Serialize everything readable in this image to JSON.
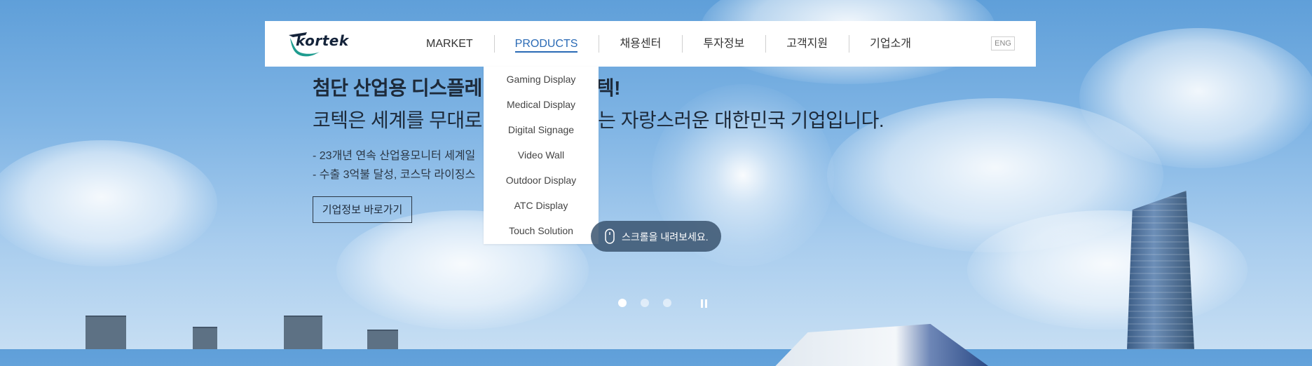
{
  "brand": {
    "logo_text": "kortek"
  },
  "nav": {
    "items": [
      {
        "label": "MARKET"
      },
      {
        "label": "PRODUCTS",
        "active": true
      },
      {
        "label": "채용센터"
      },
      {
        "label": "투자정보"
      },
      {
        "label": "고객지원"
      },
      {
        "label": "기업소개"
      }
    ],
    "lang_button": "ENG"
  },
  "hero": {
    "headline_visible_left": "첨단 산업용 디스플레",
    "headline_visible_right": "텍!",
    "subline_visible_left": "코텍은 세계를 무대로",
    "subline_visible_right": "드는 자랑스러운 대한민국 기업입니다.",
    "bullet1_visible": "- 23개년 연속 산업용모니터 세계일",
    "bullet2_visible": "- 수출 3억불 달성, 코스닥 라이징스",
    "cta_label": "기업정보 바로가기"
  },
  "products_dropdown": {
    "items": [
      "Gaming Display",
      "Medical Display",
      "Digital Signage",
      "Video Wall",
      "Outdoor Display",
      "ATC Display",
      "Touch Solution"
    ]
  },
  "scroll_hint": {
    "label": "스크롤을 내려보세요."
  },
  "slider": {
    "slide_count": 3,
    "current_slide": 1
  },
  "colors": {
    "accent": "#2a6ab5",
    "nav_text": "#333333",
    "pill_bg": "#3a546e"
  },
  "icons": {
    "mouse": "mouse-icon",
    "pause": "pause-icon"
  }
}
